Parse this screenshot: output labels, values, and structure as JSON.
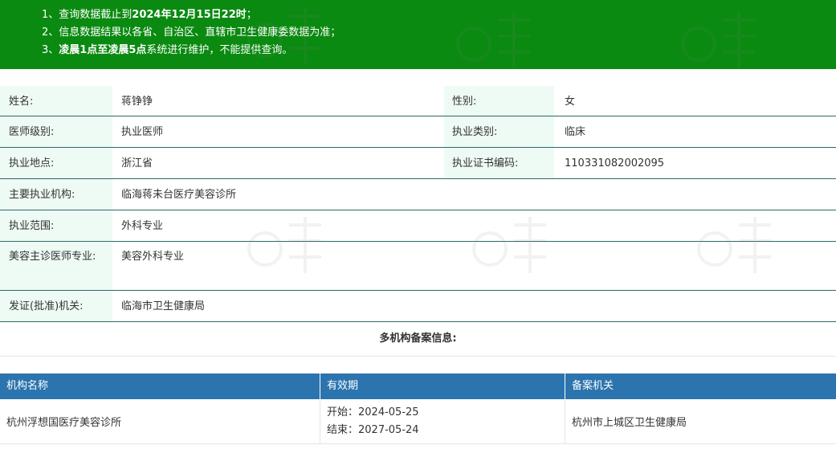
{
  "notice": {
    "line1_prefix": "1、查询数据截止到",
    "line1_bold": "2024年12月15日22时",
    "line1_suffix": "；",
    "line2": "2、信息数据结果以各省、自治区、直辖市卫生健康委数据为准；",
    "line3_prefix": "3、",
    "line3_bold": "凌晨1点至凌晨5点",
    "line3_suffix": "系统进行维护，不能提供查询。"
  },
  "info": {
    "name_label": "姓名:",
    "name": "蒋铮铮",
    "gender_label": "性别:",
    "gender": "女",
    "level_label": "医师级别:",
    "level": "执业医师",
    "category_label": "执业类别:",
    "category": "临床",
    "location_label": "执业地点:",
    "location": "浙江省",
    "cert_label": "执业证书编码:",
    "cert": "110331082002095",
    "institution_label": "主要执业机构:",
    "institution": "临海蒋未台医疗美容诊所",
    "scope_label": "执业范围:",
    "scope": "外科专业",
    "cosmetic_label": "美容主诊医师专业:",
    "cosmetic": "美容外科专业",
    "issuer_label": "发证(批准)机关:",
    "issuer": "临海市卫生健康局"
  },
  "multi": {
    "title": "多机构备案信息:",
    "headers": [
      "机构名称",
      "有效期",
      "备案机关"
    ],
    "rows": [
      {
        "name": "杭州浮想国医疗美容诊所",
        "start": "开始：2024-05-25",
        "end": "结束：2027-05-24",
        "authority": "杭州市上城区卫生健康局"
      }
    ]
  },
  "colors": {
    "notice_bg": "#0a8a10",
    "label_bg": "#eefaf4",
    "row_border": "#2a6b66",
    "table_header": "#2c74ae"
  }
}
